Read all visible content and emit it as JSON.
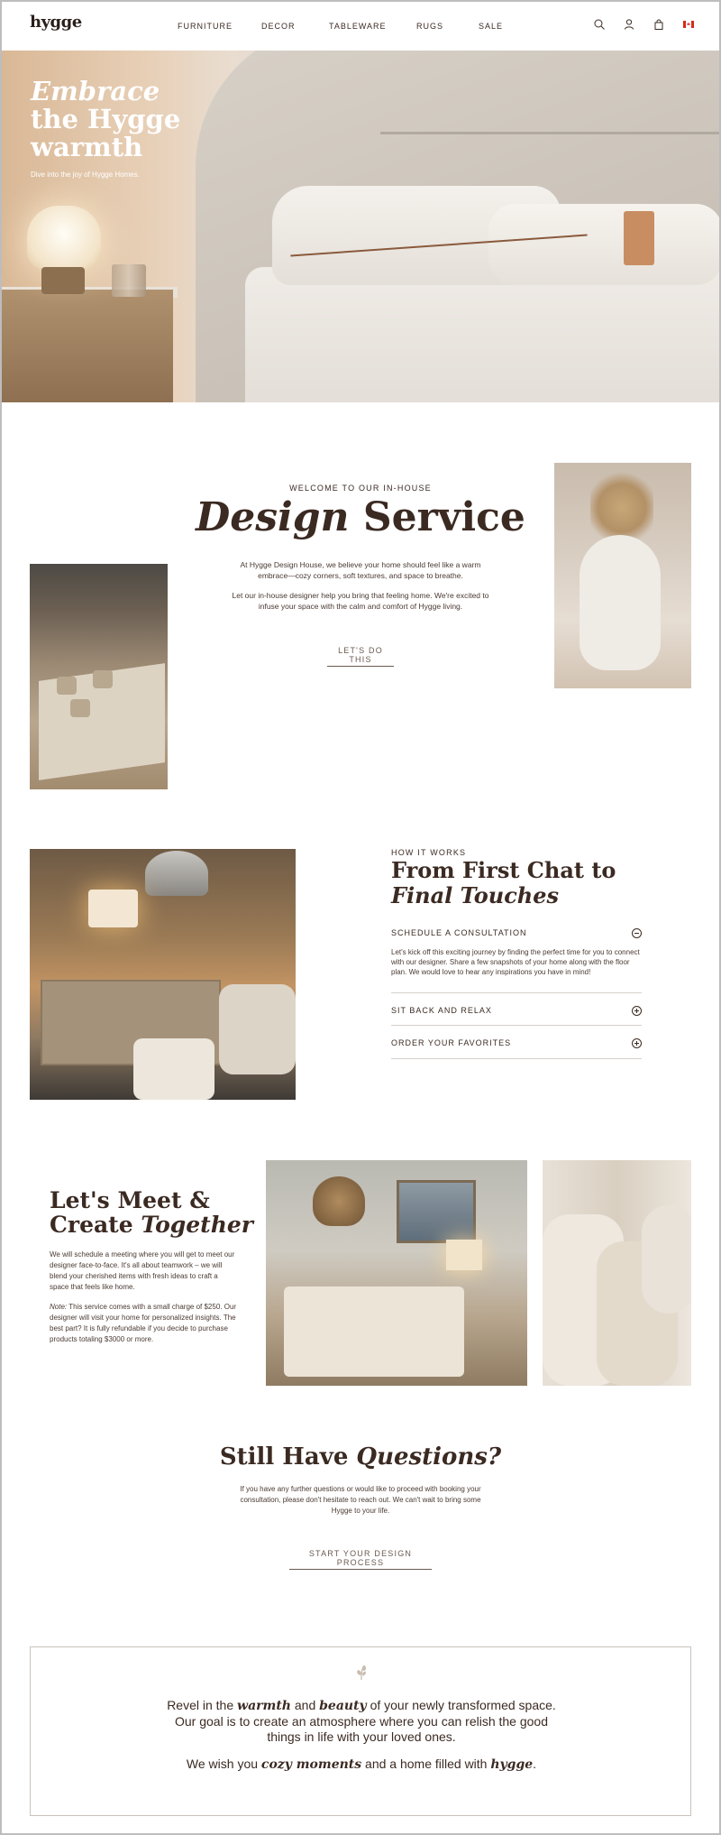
{
  "header": {
    "logo": "hygge",
    "nav": [
      "FURNITURE",
      "DECOR",
      "TABLEWARE",
      "RUGS",
      "SALE"
    ],
    "icons": [
      "search-icon",
      "user-icon",
      "bag-icon",
      "canada-flag-icon"
    ]
  },
  "hero": {
    "title_line1": "Embrace",
    "title_line2": "the Hygge",
    "title_line3": "warmth",
    "subtitle": "Dive into the joy of Hygge Homes."
  },
  "design_service": {
    "eyebrow": "WELCOME TO OUR IN-HOUSE",
    "title_italic": "Design",
    "title_rest": "Service",
    "para1": "At Hygge Design House, we believe your home should feel like a warm embrace—cozy corners, soft textures, and space to breathe.",
    "para2": "Let our in-house designer help you bring that feeling home. We're excited to infuse your space with the calm and comfort of Hygge living.",
    "cta": "LET'S DO THIS"
  },
  "how_it_works": {
    "eyebrow": "HOW IT WORKS",
    "title_line1": "From First Chat to",
    "title_line2": "Final Touches",
    "steps": [
      {
        "label": "SCHEDULE A CONSULTATION",
        "body": "Let's kick off this exciting journey by finding the perfect time for you to connect with our designer. Share a few snapshots of your home along with the floor plan. We would love to hear any inspirations you have in mind!",
        "expanded": true
      },
      {
        "label": "SIT BACK AND RELAX",
        "body": "",
        "expanded": false
      },
      {
        "label": "ORDER YOUR FAVORITES",
        "body": "",
        "expanded": false
      }
    ]
  },
  "meet": {
    "title_line1": "Let's Meet &",
    "title_line2a": "Create ",
    "title_line2b": "Together",
    "para1": "We will schedule a meeting where you will get to meet our designer face-to-face. It's all about teamwork – we will blend your cherished items with fresh ideas to craft a space that feels like home.",
    "note_label": "Note:",
    "para2": " This service comes with a small charge of $250. Our designer will visit your home for personalized insights. The best part? It is fully refundable if you decide to purchase products totaling $3000 or more."
  },
  "questions": {
    "title_a": "Still Have ",
    "title_b": "Questions?",
    "para": "If you have any further questions or would like to proceed with booking your consultation, please don't hesitate to reach out. We can't wait to bring some Hygge to your life.",
    "cta": "START YOUR DESIGN PROCESS"
  },
  "quote": {
    "icon": "sprig-icon",
    "l1a": "Revel in the ",
    "l1b": "warmth",
    "l1c": " and ",
    "l1d": "beauty",
    "l1e": " of your newly transformed space. Our goal is to create an atmosphere where you can relish the good things in life with your loved ones.",
    "l2a": "We wish you ",
    "l2b": "cozy moments",
    "l2c": " and a home filled with ",
    "l2d": "hygge",
    "l2e": "."
  },
  "colors": {
    "text": "#3b2a22",
    "accent_leather": "#c98d62",
    "flag_red": "#d52b1e"
  }
}
